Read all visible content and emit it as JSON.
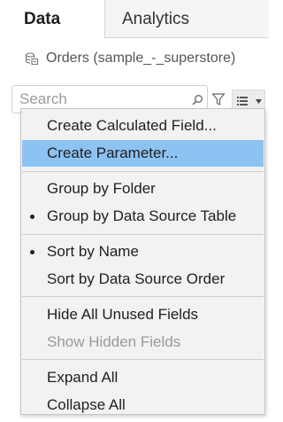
{
  "tabs": [
    {
      "label": "Data"
    },
    {
      "label": "Analytics"
    }
  ],
  "datasource": {
    "icon": "datasource-icon",
    "label": "Orders (sample_-_superstore)"
  },
  "search": {
    "placeholder": "Search",
    "icon": "search-icon"
  },
  "toolbar": {
    "filter_icon": "filter-icon",
    "view_menu_icon": "list-view-icon"
  },
  "menu": {
    "items": [
      {
        "label": "Create Calculated Field...",
        "checked": false,
        "highlighted": false,
        "enabled": true
      },
      {
        "label": "Create Parameter...",
        "checked": false,
        "highlighted": true,
        "enabled": true
      },
      {
        "label": "Group by Folder",
        "checked": false,
        "highlighted": false,
        "enabled": true
      },
      {
        "label": "Group by Data Source Table",
        "checked": true,
        "highlighted": false,
        "enabled": true
      },
      {
        "label": "Sort by Name",
        "checked": true,
        "highlighted": false,
        "enabled": true
      },
      {
        "label": "Sort by Data Source Order",
        "checked": false,
        "highlighted": false,
        "enabled": true
      },
      {
        "label": "Hide All Unused Fields",
        "checked": false,
        "highlighted": false,
        "enabled": true
      },
      {
        "label": "Show Hidden Fields",
        "checked": false,
        "highlighted": false,
        "enabled": false
      },
      {
        "label": "Expand All",
        "checked": false,
        "highlighted": false,
        "enabled": true
      },
      {
        "label": "Collapse All",
        "checked": false,
        "highlighted": false,
        "enabled": true
      }
    ]
  },
  "colors": {
    "highlight": "#8dc3f2",
    "menu_bg": "#f2f2f2",
    "disabled_text": "#9a9a9a"
  }
}
